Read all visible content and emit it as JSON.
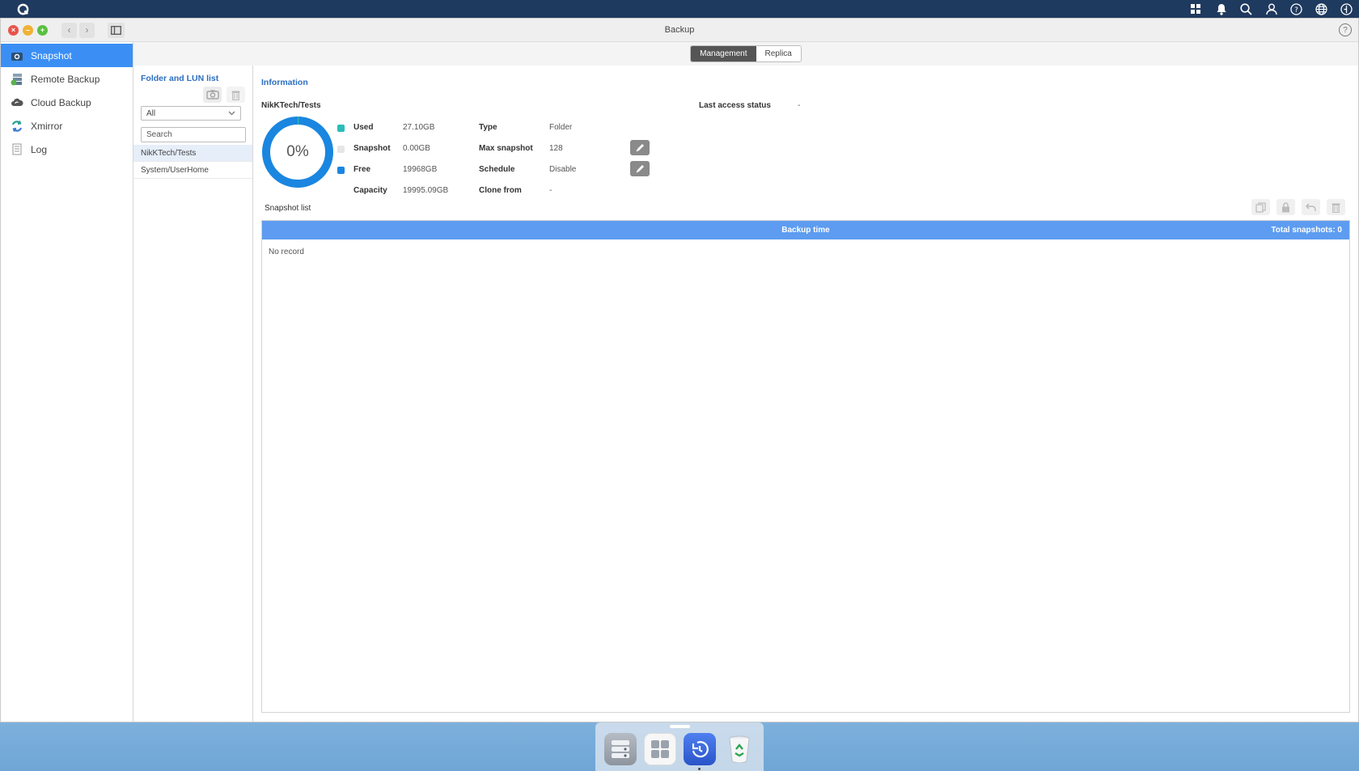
{
  "window": {
    "title": "Backup"
  },
  "nav": {
    "items": [
      {
        "label": "Snapshot",
        "icon": "camera-icon",
        "active": true
      },
      {
        "label": "Remote Backup",
        "icon": "remote-backup-icon",
        "active": false
      },
      {
        "label": "Cloud Backup",
        "icon": "cloud-backup-icon",
        "active": false
      },
      {
        "label": "Xmirror",
        "icon": "sync-icon",
        "active": false
      },
      {
        "label": "Log",
        "icon": "log-icon",
        "active": false
      }
    ]
  },
  "tabs": [
    {
      "label": "Management",
      "active": true
    },
    {
      "label": "Replica",
      "active": false
    }
  ],
  "folder_pane": {
    "title": "Folder and LUN list",
    "filter_value": "All",
    "search_placeholder": "Search",
    "items": [
      {
        "label": "NikKTech/Tests",
        "selected": true
      },
      {
        "label": "System/UserHome",
        "selected": false
      }
    ]
  },
  "info": {
    "title": "Information",
    "share_name": "NikKTech/Tests",
    "last_access_label": "Last access status",
    "last_access_value": "-",
    "usage_percent_text": "0%",
    "usage_fraction": 0.0014,
    "stats": [
      {
        "label": "Used",
        "value": "27.10GB",
        "color": "#2bbcb8"
      },
      {
        "label": "Snapshot",
        "value": "0.00GB",
        "color": "#e6e6e6"
      },
      {
        "label": "Free",
        "value": "19968GB",
        "color": "#1a86e0"
      },
      {
        "label": "Capacity",
        "value": "19995.09GB"
      }
    ],
    "props": [
      {
        "label": "Type",
        "value": "Folder"
      },
      {
        "label": "Max snapshot",
        "value": "128"
      },
      {
        "label": "Schedule",
        "value": "Disable"
      },
      {
        "label": "Clone from",
        "value": "-"
      }
    ]
  },
  "snapshot_list": {
    "label": "Snapshot list",
    "column_header": "Backup time",
    "total_text": "Total snapshots: 0",
    "empty_text": "No record"
  },
  "colors": {
    "accent": "#3b8ff4",
    "table_header": "#5d9cf0",
    "donut_free": "#1a86e0",
    "donut_used": "#2bbcb8",
    "title_blue": "#2c6fbf"
  }
}
